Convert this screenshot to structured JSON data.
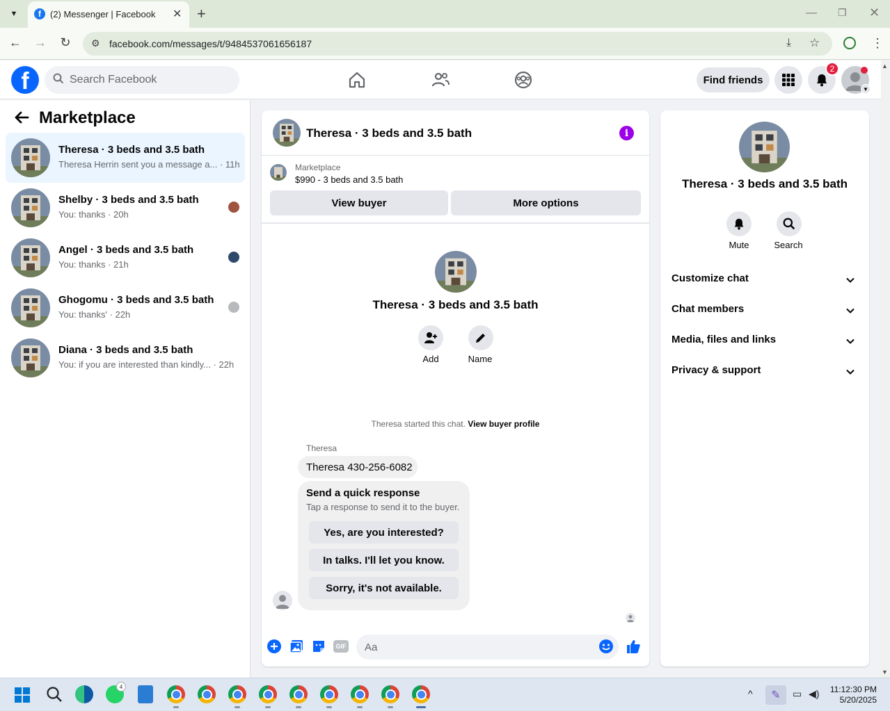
{
  "browser": {
    "tab_title": "(2) Messenger | Facebook",
    "url": "facebook.com/messages/t/9484537061656187"
  },
  "header": {
    "search_placeholder": "Search Facebook",
    "find_friends": "Find friends",
    "notification_count": "2"
  },
  "left": {
    "title": "Marketplace",
    "conversations": [
      {
        "name": "Theresa · 3 beds and 3.5 bath",
        "preview": "Theresa Herrin sent you a message a... · 11h"
      },
      {
        "name": "Shelby · 3 beds and 3.5 bath",
        "preview": "You: thanks · 20h"
      },
      {
        "name": "Angel · 3 beds and 3.5 bath",
        "preview": "You: thanks · 21h"
      },
      {
        "name": "Ghogomu · 3 beds and 3.5 bath",
        "preview": "You: thanks' · 22h"
      },
      {
        "name": "Diana · 3 beds and 3.5 bath",
        "preview": "You: if you are interested than kindly... · 22h"
      }
    ]
  },
  "chat": {
    "title": "Theresa · 3 beds and 3.5 bath",
    "marketplace_label": "Marketplace",
    "listing": "$990 - 3 beds and 3.5 bath",
    "view_buyer": "View buyer",
    "more_options": "More options",
    "profile_title": "Theresa · 3 beds and 3.5 bath",
    "add_label": "Add",
    "name_label": "Name",
    "started_text": "Theresa started this chat.",
    "view_buyer_profile": "View buyer profile",
    "sender": "Theresa",
    "message": "Theresa 430-256-6082",
    "quick_title": "Send a quick response",
    "quick_sub": "Tap a response to send it to the buyer.",
    "quick_responses": [
      "Yes, are you interested?",
      "In talks. I'll let you know.",
      "Sorry, it's not available."
    ],
    "composer_placeholder": "Aa",
    "gif_label": "GIF"
  },
  "right": {
    "title": "Theresa · 3 beds and 3.5 bath",
    "mute": "Mute",
    "search": "Search",
    "sections": [
      "Customize chat",
      "Chat members",
      "Media, files and links",
      "Privacy & support"
    ]
  },
  "taskbar": {
    "whatsapp_badge": "4",
    "time": "11:12:30 PM",
    "date": "5/20/2025"
  },
  "colors": {
    "facebook_blue": "#0866ff",
    "messenger_accent": "#0866ff",
    "info_purple": "#9b00e8",
    "badge_red": "#e41e3f",
    "active_conv": "#ebf5ff"
  }
}
